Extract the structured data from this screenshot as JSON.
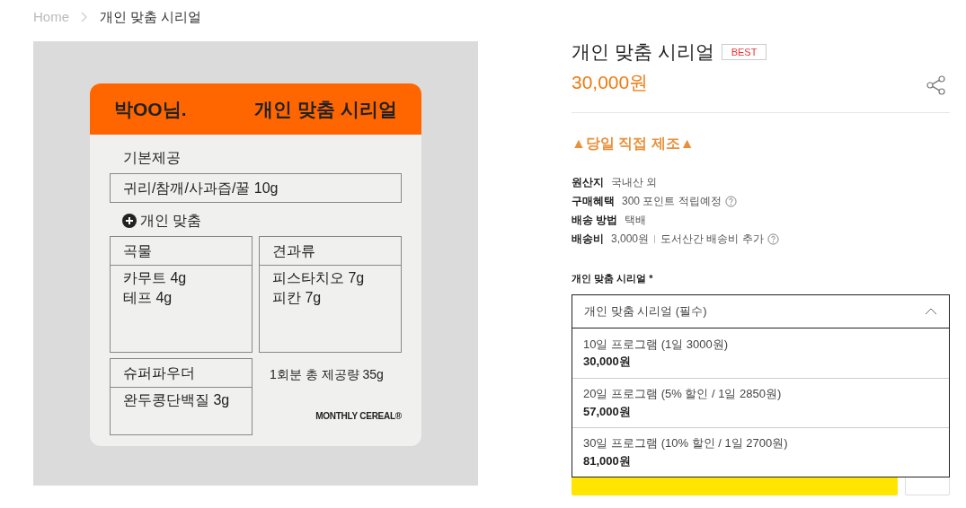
{
  "breadcrumb": {
    "home": "Home",
    "current": "개인 맞춤 시리얼"
  },
  "label_card": {
    "customer": "박OO님.",
    "title": "개인 맞춤 시리얼",
    "base_heading": "기본제공",
    "base_items": "귀리/참깨/사과즙/꿀 10g",
    "custom_heading": "개인 맞춤",
    "boxes": [
      {
        "heading": "곡물",
        "lines": [
          "카무트 4g",
          "테프 4g"
        ]
      },
      {
        "heading": "견과류",
        "lines": [
          "피스타치오 7g",
          "피칸 7g"
        ]
      },
      {
        "heading": "슈퍼파우더",
        "lines": [
          "완두콩단백질 3g"
        ]
      }
    ],
    "total": "1회분 총 제공량 35g",
    "brand": "MONTHLY CEREAL®"
  },
  "product": {
    "title": "개인 맞춤 시리얼",
    "badge": "BEST",
    "price": "30,000원",
    "notice": "▲당일 직접 제조▲",
    "info": [
      {
        "label": "원산지",
        "value": "국내산 외",
        "help": false
      },
      {
        "label": "구매혜택",
        "value": "300 포인트 적립예정",
        "help": true
      },
      {
        "label": "배송 방법",
        "value": "택배",
        "help": false
      },
      {
        "label": "배송비",
        "value": "3,000원",
        "note": "도서산간 배송비 추가",
        "help": true
      }
    ]
  },
  "option": {
    "label": "개인 맞춤 시리얼 *",
    "placeholder": "개인 맞춤 시리얼 (필수)",
    "expanded": true,
    "choices": [
      {
        "name": "10일 프로그램 (1일 3000원)",
        "price": "30,000원"
      },
      {
        "name": "20일 프로그램 (5% 할인 / 1일 2850원)",
        "price": "57,000원"
      },
      {
        "name": "30일 프로그램 (10% 할인 / 1일 2700원)",
        "price": "81,000원"
      }
    ]
  }
}
